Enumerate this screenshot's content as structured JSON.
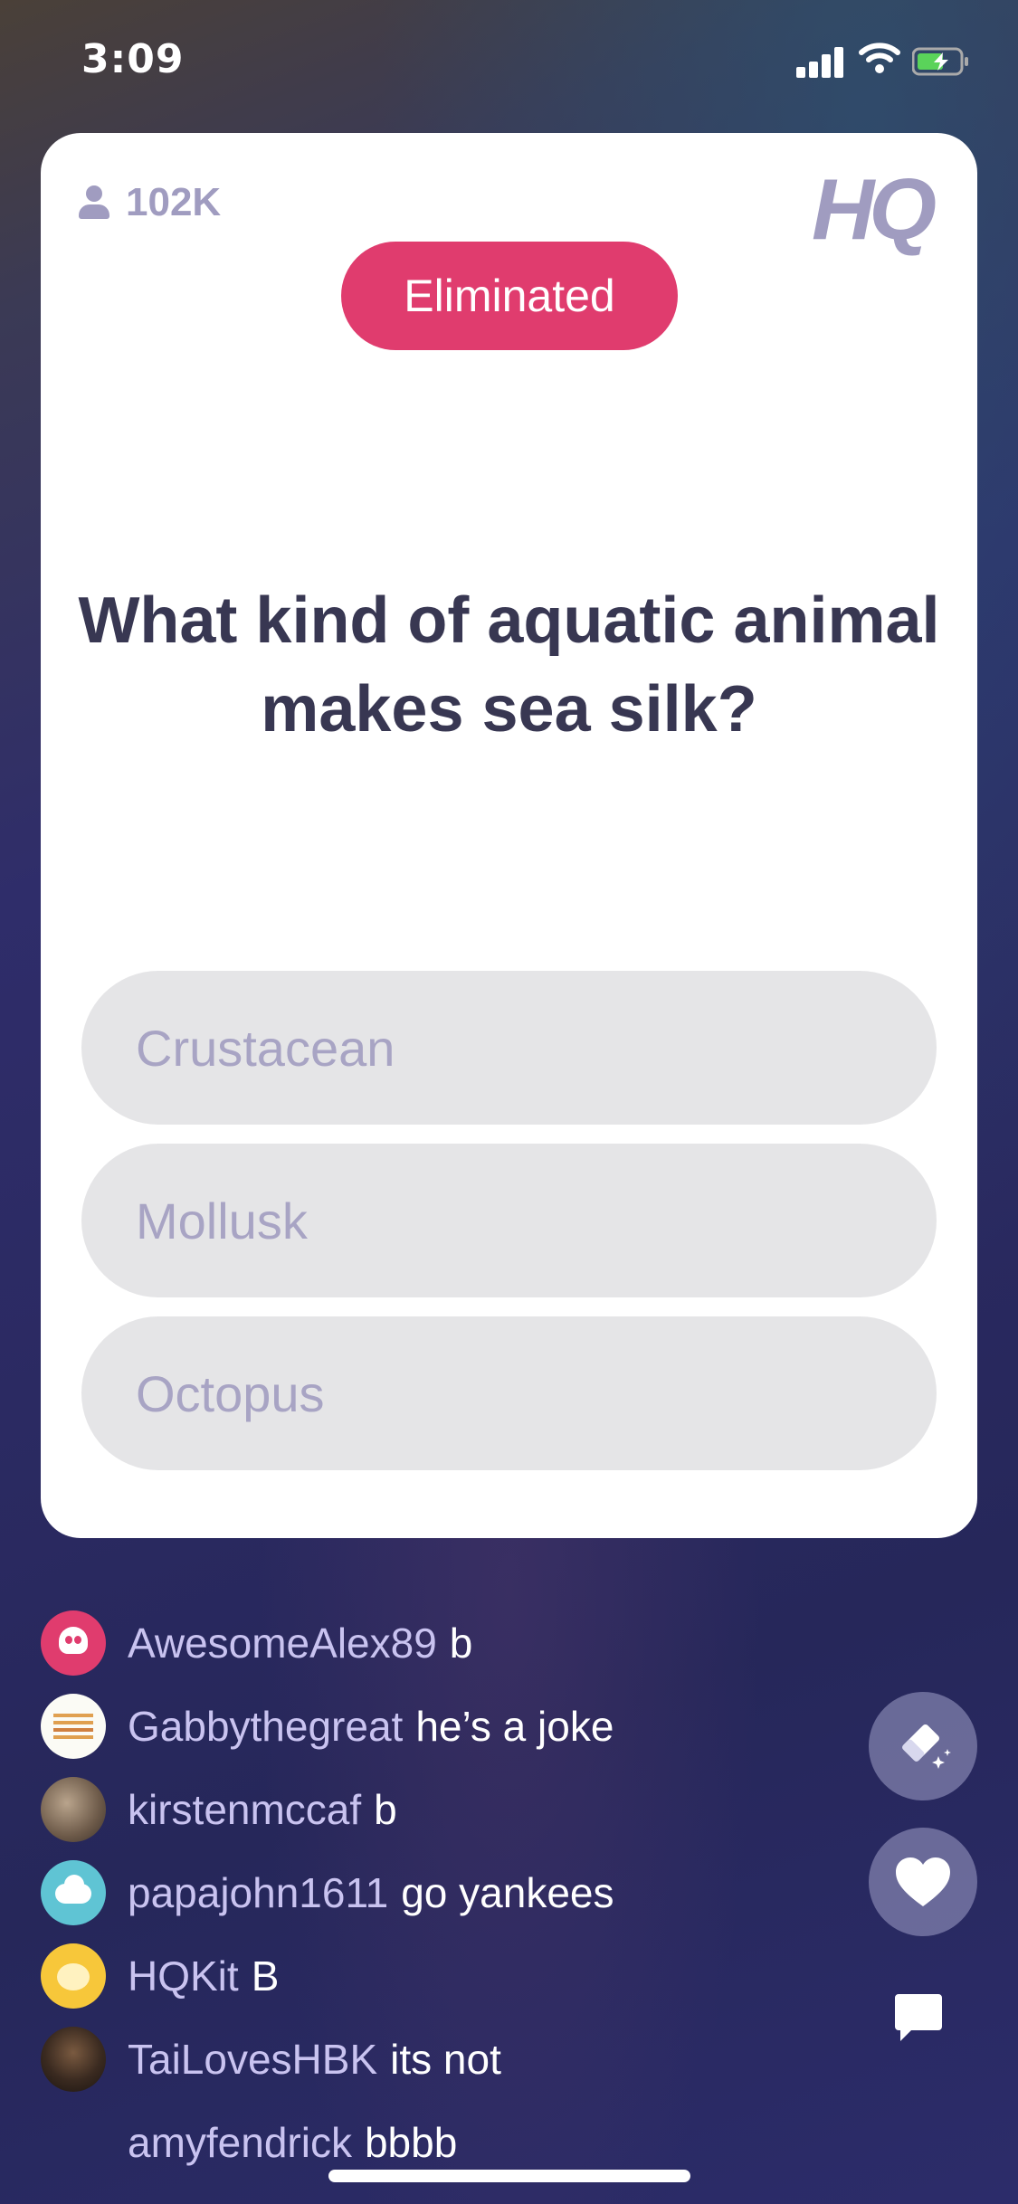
{
  "status_bar": {
    "time": "3:09",
    "signal_icon": "cellular-signal-icon",
    "wifi_icon": "wifi-icon",
    "battery_icon": "battery-charging-icon"
  },
  "game": {
    "viewer_count": "102K",
    "logo": "HQ",
    "status_badge": "Eliminated",
    "question": "What kind of aquatic animal makes sea silk?",
    "answers": [
      {
        "label": "Crustacean"
      },
      {
        "label": "Mollusk"
      },
      {
        "label": "Octopus"
      }
    ]
  },
  "chat": [
    {
      "user": "AwesomeAlex89",
      "message": "b",
      "avatar": "skull"
    },
    {
      "user": "Gabbythegreat",
      "message": "he’s a joke",
      "avatar": "paper"
    },
    {
      "user": "kirstenmccaf",
      "message": "b",
      "avatar": "cat-photo"
    },
    {
      "user": "papajohn1611",
      "message": "go yankees",
      "avatar": "cloud"
    },
    {
      "user": "HQKit",
      "message": "B",
      "avatar": "bear"
    },
    {
      "user": "TaiLovesHBK",
      "message": "its not",
      "avatar": "person-photo"
    },
    {
      "user": "amyfendrick",
      "message": "bbbb",
      "avatar": "none"
    }
  ],
  "controls": {
    "eraser_icon": "eraser-icon",
    "heart_icon": "heart-icon",
    "chat_icon": "chat-bubble-icon"
  },
  "colors": {
    "badge": "#e03c6e",
    "question_text": "#383752",
    "answer_bg": "#e5e5e7",
    "answer_text": "#a8a4c4",
    "muted": "#a09cc0",
    "chat_user": "#c9c3f0"
  }
}
